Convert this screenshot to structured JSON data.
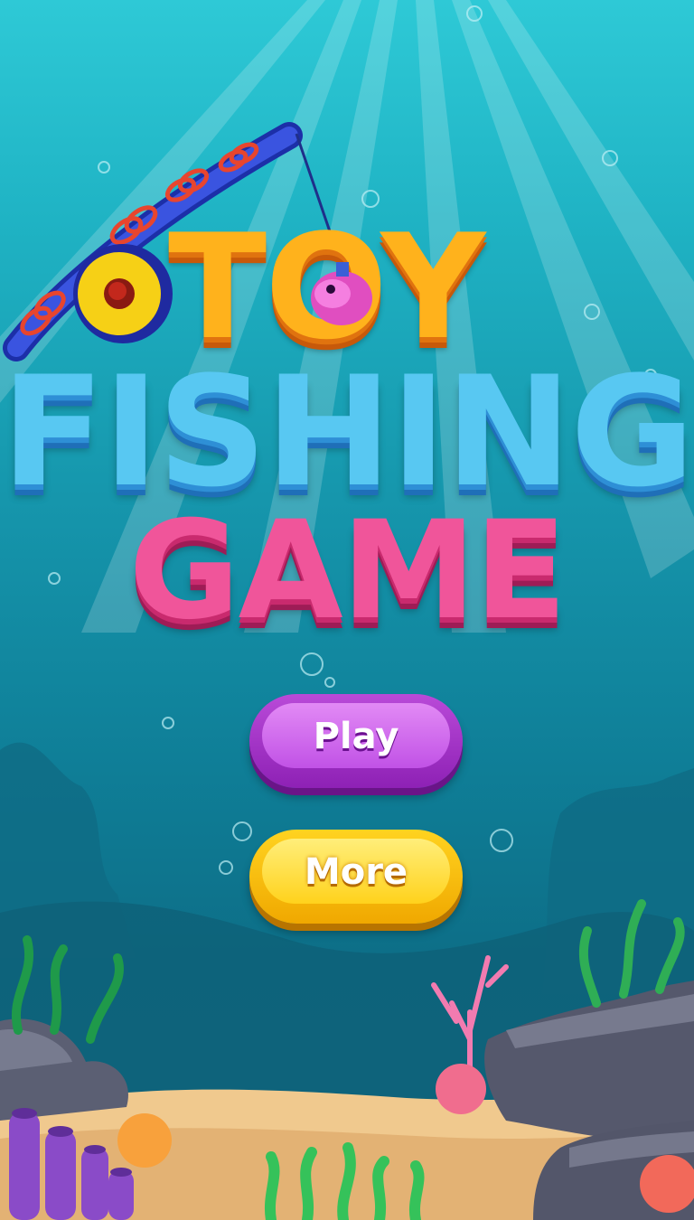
{
  "title": {
    "line1": "TOY",
    "line2": "FISHING",
    "line3": "GAME"
  },
  "menu": {
    "play_label": "Play",
    "more_label": "More"
  },
  "colors": {
    "water_top": "#2ec9d6",
    "water_bottom": "#0f6a82",
    "title_toy": "#ffb21c",
    "title_fishing": "#58c8f2",
    "title_game": "#f0559a",
    "play_button": "#a935cf",
    "more_button": "#ffd21c"
  },
  "icons": [
    "fishing-rod-icon",
    "reel-icon",
    "toy-fish-icon",
    "coral-icon",
    "seaweed-icon",
    "rock-icon",
    "bubble-icon"
  ]
}
